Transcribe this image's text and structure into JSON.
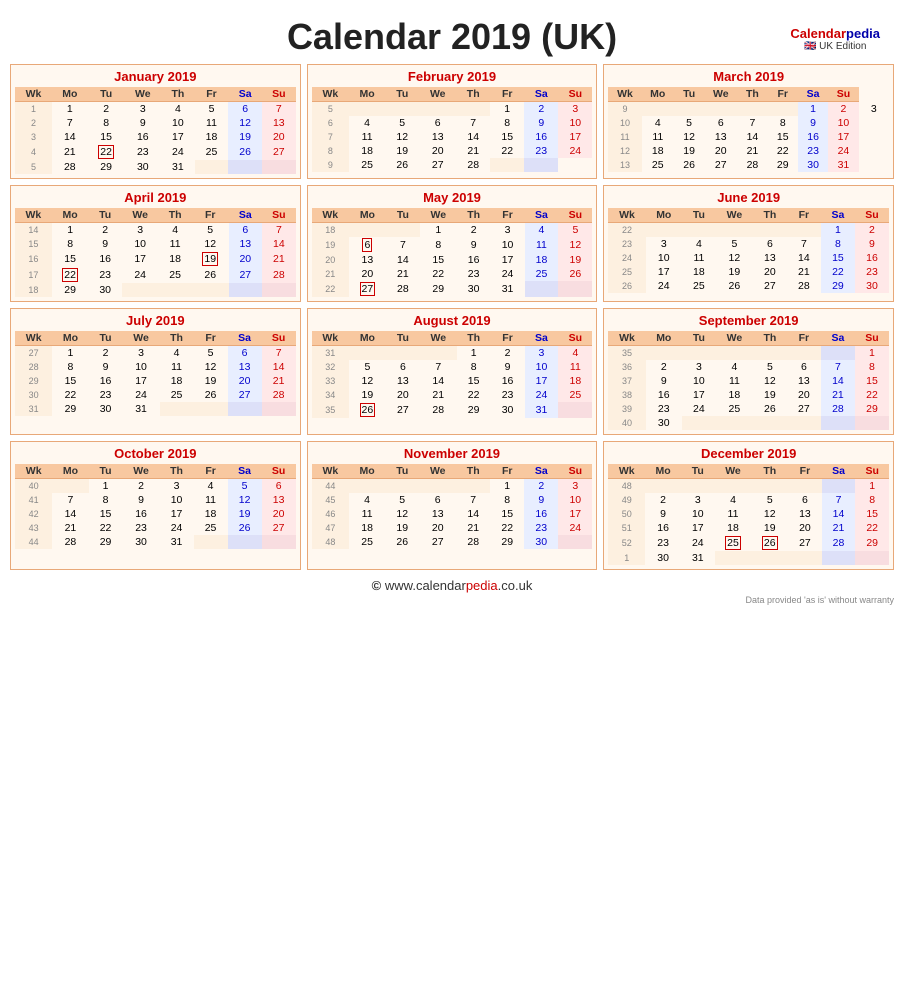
{
  "page": {
    "title": "Calendar 2019 (UK)",
    "footer_url": "© www.calendarpedia.co.uk",
    "footer_note": "Data provided 'as is' without warranty",
    "logo_main": "Calendar",
    "logo_pedia": "pedia",
    "logo_edition": "🇬🇧 UK Edition"
  },
  "months": [
    {
      "name": "January 2019",
      "weeks": [
        {
          "wk": 1,
          "days": [
            "1",
            "2",
            "3",
            "4",
            "5",
            "6",
            "7"
          ],
          "start_dow": 0,
          "empties_before": 0
        },
        {
          "wk": 2,
          "days": [
            "7",
            "8",
            "9",
            "10",
            "11",
            "12",
            "13"
          ]
        },
        {
          "wk": 3,
          "days": [
            "14",
            "15",
            "16",
            "17",
            "18",
            "19",
            "20"
          ]
        },
        {
          "wk": 4,
          "days": [
            "21",
            "22",
            "23",
            "24",
            "25",
            "26",
            "27"
          ]
        },
        {
          "wk": 5,
          "days": [
            "28",
            "29",
            "30",
            "31",
            "",
            "",
            ""
          ]
        }
      ],
      "holidays": [
        "1"
      ],
      "special_box": [
        "22"
      ]
    },
    {
      "name": "February 2019",
      "weeks": [
        {
          "wk": 5,
          "days": [
            "",
            "",
            "",
            "",
            "1",
            "2",
            "3"
          ]
        },
        {
          "wk": 6,
          "days": [
            "4",
            "5",
            "6",
            "7",
            "8",
            "9",
            "10"
          ]
        },
        {
          "wk": 7,
          "days": [
            "11",
            "12",
            "13",
            "14",
            "15",
            "16",
            "17"
          ]
        },
        {
          "wk": 8,
          "days": [
            "18",
            "19",
            "20",
            "21",
            "22",
            "23",
            "24"
          ]
        },
        {
          "wk": 9,
          "days": [
            "25",
            "26",
            "27",
            "28",
            "",
            ""
          ]
        }
      ],
      "holidays": [],
      "special_box": []
    },
    {
      "name": "March 2019",
      "weeks": [
        {
          "wk": 9,
          "days": [
            "",
            "",
            "",
            "",
            "",
            "1",
            "2",
            "3"
          ]
        },
        {
          "wk": 10,
          "days": [
            "4",
            "5",
            "6",
            "7",
            "8",
            "9",
            "10"
          ]
        },
        {
          "wk": 11,
          "days": [
            "11",
            "12",
            "13",
            "14",
            "15",
            "16",
            "17"
          ]
        },
        {
          "wk": 12,
          "days": [
            "18",
            "19",
            "20",
            "21",
            "22",
            "23",
            "24"
          ]
        },
        {
          "wk": 13,
          "days": [
            "25",
            "26",
            "27",
            "28",
            "29",
            "30",
            "31"
          ]
        }
      ],
      "holidays": [],
      "special_box": []
    },
    {
      "name": "April 2019",
      "weeks": [
        {
          "wk": 14,
          "days": [
            "1",
            "2",
            "3",
            "4",
            "5",
            "6",
            "7"
          ]
        },
        {
          "wk": 15,
          "days": [
            "8",
            "9",
            "10",
            "11",
            "12",
            "13",
            "14"
          ]
        },
        {
          "wk": 16,
          "days": [
            "15",
            "16",
            "17",
            "18",
            "19",
            "20",
            "21"
          ]
        },
        {
          "wk": 17,
          "days": [
            "22",
            "23",
            "24",
            "25",
            "26",
            "27",
            "28"
          ]
        },
        {
          "wk": 18,
          "days": [
            "29",
            "30",
            "",
            "",
            "",
            "",
            ""
          ]
        }
      ],
      "holidays": [],
      "special_box": [
        "19",
        "22"
      ]
    },
    {
      "name": "May 2019",
      "weeks": [
        {
          "wk": 18,
          "days": [
            "",
            "",
            "1",
            "2",
            "3",
            "4",
            "5"
          ]
        },
        {
          "wk": 19,
          "days": [
            "6",
            "7",
            "8",
            "9",
            "10",
            "11",
            "12"
          ]
        },
        {
          "wk": 20,
          "days": [
            "13",
            "14",
            "15",
            "16",
            "17",
            "18",
            "19"
          ]
        },
        {
          "wk": 21,
          "days": [
            "20",
            "21",
            "22",
            "23",
            "24",
            "25",
            "26"
          ]
        },
        {
          "wk": 22,
          "days": [
            "27",
            "28",
            "29",
            "30",
            "31",
            "",
            ""
          ]
        }
      ],
      "holidays": [],
      "special_box": [
        "6",
        "27"
      ]
    },
    {
      "name": "June 2019",
      "weeks": [
        {
          "wk": 22,
          "days": [
            "",
            "",
            "",
            "",
            "",
            "1",
            "2"
          ]
        },
        {
          "wk": 23,
          "days": [
            "3",
            "4",
            "5",
            "6",
            "7",
            "8",
            "9"
          ]
        },
        {
          "wk": 24,
          "days": [
            "10",
            "11",
            "12",
            "13",
            "14",
            "15",
            "16"
          ]
        },
        {
          "wk": 25,
          "days": [
            "17",
            "18",
            "19",
            "20",
            "21",
            "22",
            "23"
          ]
        },
        {
          "wk": 26,
          "days": [
            "24",
            "25",
            "26",
            "27",
            "28",
            "29",
            "30"
          ]
        }
      ],
      "holidays": [],
      "special_box": []
    },
    {
      "name": "July 2019",
      "weeks": [
        {
          "wk": 27,
          "days": [
            "1",
            "2",
            "3",
            "4",
            "5",
            "6",
            "7"
          ]
        },
        {
          "wk": 28,
          "days": [
            "8",
            "9",
            "10",
            "11",
            "12",
            "13",
            "14"
          ]
        },
        {
          "wk": 29,
          "days": [
            "15",
            "16",
            "17",
            "18",
            "19",
            "20",
            "21"
          ]
        },
        {
          "wk": 30,
          "days": [
            "22",
            "23",
            "24",
            "25",
            "26",
            "27",
            "28"
          ]
        },
        {
          "wk": 31,
          "days": [
            "29",
            "30",
            "31",
            "",
            "",
            "",
            ""
          ]
        }
      ],
      "holidays": [],
      "special_box": []
    },
    {
      "name": "August 2019",
      "weeks": [
        {
          "wk": 31,
          "days": [
            "",
            "",
            "",
            "1",
            "2",
            "3",
            "4"
          ]
        },
        {
          "wk": 32,
          "days": [
            "5",
            "6",
            "7",
            "8",
            "9",
            "10",
            "11"
          ]
        },
        {
          "wk": 33,
          "days": [
            "12",
            "13",
            "14",
            "15",
            "16",
            "17",
            "18"
          ]
        },
        {
          "wk": 34,
          "days": [
            "19",
            "20",
            "21",
            "22",
            "23",
            "24",
            "25"
          ]
        },
        {
          "wk": 35,
          "days": [
            "26",
            "27",
            "28",
            "29",
            "30",
            "31",
            ""
          ]
        }
      ],
      "holidays": [],
      "special_box": [
        "26"
      ]
    },
    {
      "name": "September 2019",
      "weeks": [
        {
          "wk": 35,
          "days": [
            "",
            "",
            "",
            "",
            "",
            "",
            "1"
          ]
        },
        {
          "wk": 36,
          "days": [
            "2",
            "3",
            "4",
            "5",
            "6",
            "7",
            "8"
          ]
        },
        {
          "wk": 37,
          "days": [
            "9",
            "10",
            "11",
            "12",
            "13",
            "14",
            "15"
          ]
        },
        {
          "wk": 38,
          "days": [
            "16",
            "17",
            "18",
            "19",
            "20",
            "21",
            "22"
          ]
        },
        {
          "wk": 39,
          "days": [
            "23",
            "24",
            "25",
            "26",
            "27",
            "28",
            "29"
          ]
        },
        {
          "wk": 40,
          "days": [
            "30",
            "",
            "",
            "",
            "",
            "",
            ""
          ]
        }
      ],
      "holidays": [],
      "special_box": []
    },
    {
      "name": "October 2019",
      "weeks": [
        {
          "wk": 40,
          "days": [
            "",
            "1",
            "2",
            "3",
            "4",
            "5",
            "6"
          ]
        },
        {
          "wk": 41,
          "days": [
            "7",
            "8",
            "9",
            "10",
            "11",
            "12",
            "13"
          ]
        },
        {
          "wk": 42,
          "days": [
            "14",
            "15",
            "16",
            "17",
            "18",
            "19",
            "20"
          ]
        },
        {
          "wk": 43,
          "days": [
            "21",
            "22",
            "23",
            "24",
            "25",
            "26",
            "27"
          ]
        },
        {
          "wk": 44,
          "days": [
            "28",
            "29",
            "30",
            "31",
            "",
            "",
            ""
          ]
        }
      ],
      "holidays": [],
      "special_box": []
    },
    {
      "name": "November 2019",
      "weeks": [
        {
          "wk": 44,
          "days": [
            "",
            "",
            "",
            "",
            "1",
            "2",
            "3"
          ]
        },
        {
          "wk": 45,
          "days": [
            "4",
            "5",
            "6",
            "7",
            "8",
            "9",
            "10"
          ]
        },
        {
          "wk": 46,
          "days": [
            "11",
            "12",
            "13",
            "14",
            "15",
            "16",
            "17"
          ]
        },
        {
          "wk": 47,
          "days": [
            "18",
            "19",
            "20",
            "21",
            "22",
            "23",
            "24"
          ]
        },
        {
          "wk": 48,
          "days": [
            "25",
            "26",
            "27",
            "28",
            "29",
            "30",
            ""
          ]
        }
      ],
      "holidays": [],
      "special_box": []
    },
    {
      "name": "December 2019",
      "weeks": [
        {
          "wk": 48,
          "days": [
            "",
            "",
            "",
            "",
            "",
            "",
            "1"
          ]
        },
        {
          "wk": 49,
          "days": [
            "2",
            "3",
            "4",
            "5",
            "6",
            "7",
            "8"
          ]
        },
        {
          "wk": 50,
          "days": [
            "9",
            "10",
            "11",
            "12",
            "13",
            "14",
            "15"
          ]
        },
        {
          "wk": 51,
          "days": [
            "16",
            "17",
            "18",
            "19",
            "20",
            "21",
            "22"
          ]
        },
        {
          "wk": 52,
          "days": [
            "23",
            "24",
            "25",
            "26",
            "27",
            "28",
            "29"
          ]
        },
        {
          "wk": 1,
          "days": [
            "30",
            "31",
            "",
            "",
            "",
            "",
            ""
          ]
        }
      ],
      "holidays": [
        "25",
        "26"
      ],
      "special_box": [
        "25",
        "26"
      ]
    }
  ]
}
